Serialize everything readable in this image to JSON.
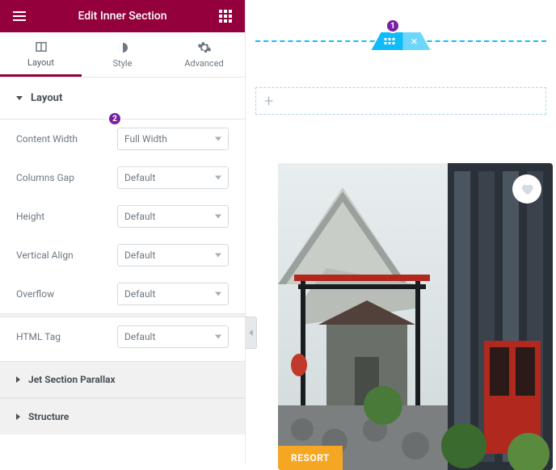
{
  "header": {
    "title": "Edit Inner Section"
  },
  "callouts": {
    "one": "1",
    "two": "2"
  },
  "tabs": {
    "layout": "Layout",
    "style": "Style",
    "advanced": "Advanced"
  },
  "sections": {
    "layout": "Layout",
    "parallax": "Jet Section Parallax",
    "structure": "Structure"
  },
  "controls": {
    "content_width": {
      "label": "Content Width",
      "value": "Full Width"
    },
    "columns_gap": {
      "label": "Columns Gap",
      "value": "Default"
    },
    "height": {
      "label": "Height",
      "value": "Default"
    },
    "vertical_align": {
      "label": "Vertical Align",
      "value": "Default"
    },
    "overflow": {
      "label": "Overflow",
      "value": "Default"
    },
    "html_tag": {
      "label": "HTML Tag",
      "value": "Default"
    }
  },
  "card": {
    "badge": "RESORT"
  },
  "icons": {
    "plus": "+",
    "close": "×"
  }
}
